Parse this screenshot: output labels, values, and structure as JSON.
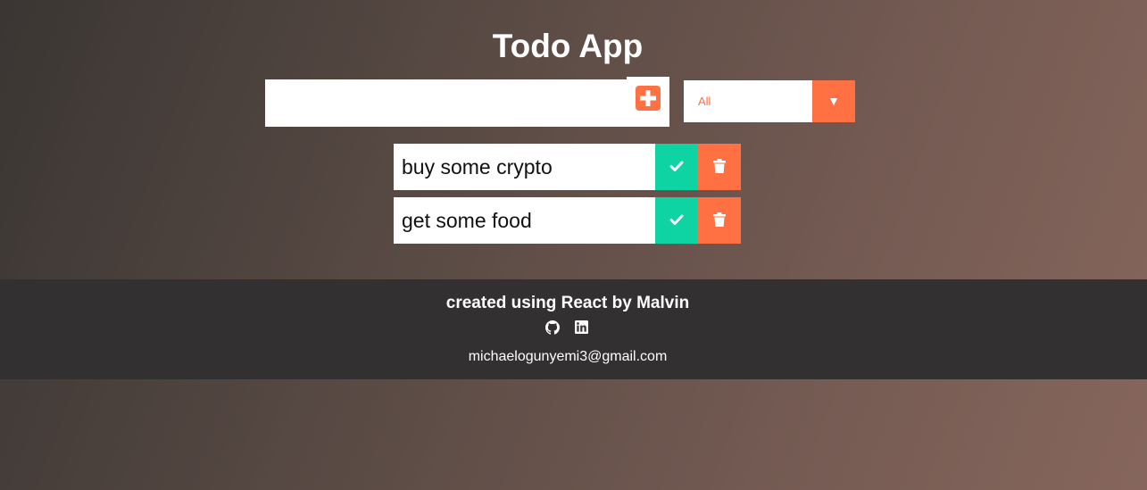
{
  "header": {
    "title": "Todo App"
  },
  "form": {
    "input_value": "",
    "add_icon": "plus-square-icon",
    "filter": {
      "selected": "All",
      "arrow_icon": "caret-down-icon"
    }
  },
  "todos": [
    {
      "text": "buy some crypto",
      "complete_icon": "check-icon",
      "delete_icon": "trash-icon"
    },
    {
      "text": "get some food",
      "complete_icon": "check-icon",
      "delete_icon": "trash-icon"
    }
  ],
  "footer": {
    "credit": "created using React by Malvin",
    "icons": [
      "github-icon",
      "linkedin-icon"
    ],
    "email": "michaelogunyemi3@gmail.com"
  },
  "colors": {
    "accent": "#ff7043",
    "complete": "#0ed4a4",
    "footer_bg": "#323031"
  }
}
